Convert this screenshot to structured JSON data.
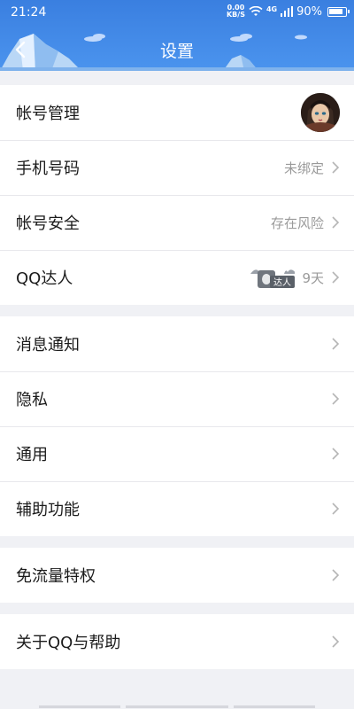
{
  "status": {
    "time": "21:24",
    "net_speed_top": "0.00",
    "net_speed_unit": "KB/S",
    "network": "4G",
    "battery": "90%",
    "battery_level": 0.9
  },
  "header": {
    "title": "设置"
  },
  "groups": [
    {
      "rows": [
        {
          "label": "帐号管理",
          "value": ""
        },
        {
          "label": "手机号码",
          "value": "未绑定"
        },
        {
          "label": "帐号安全",
          "value": "存在风险"
        },
        {
          "label": "QQ达人",
          "value": "9天",
          "badge": "达人"
        }
      ]
    },
    {
      "rows": [
        {
          "label": "消息通知"
        },
        {
          "label": "隐私"
        },
        {
          "label": "通用"
        },
        {
          "label": "辅助功能"
        }
      ]
    },
    {
      "rows": [
        {
          "label": "免流量特权"
        }
      ]
    },
    {
      "rows": [
        {
          "label": "关于QQ与帮助"
        }
      ]
    }
  ],
  "colors": {
    "header": "#3a7fe0",
    "background": "#f0f1f5",
    "value_text": "#9a9a9a"
  },
  "icons": [
    "back-arrow-icon",
    "wifi-icon",
    "signal-icon",
    "battery-icon",
    "chevron-right-icon",
    "qq-daren-badge-icon"
  ]
}
